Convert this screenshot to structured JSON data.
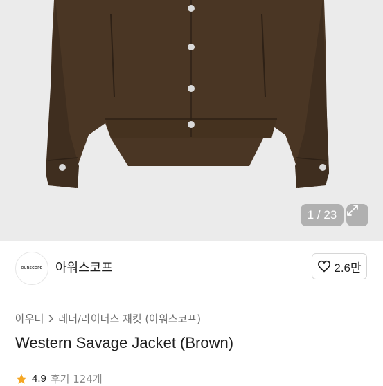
{
  "gallery": {
    "current": "1",
    "separator": "/",
    "total": "23",
    "counter_text": "1 / 23",
    "background": "#ebebeb",
    "product_color": "#4a3624"
  },
  "seller": {
    "logo_text": "OURSCOPE",
    "name": "아워스코프",
    "likes": "2.6만",
    "icon": "heart-icon"
  },
  "breadcrumb": {
    "category": "아우터",
    "separator_icon": "chevron-right-icon",
    "subcategory": "레더/라이더스 재킷 (아워스코프)"
  },
  "product": {
    "title": "Western Savage Jacket (Brown)"
  },
  "rating": {
    "score": "4.9",
    "reviews": "후기 124개",
    "star_color": "#f5a623"
  }
}
